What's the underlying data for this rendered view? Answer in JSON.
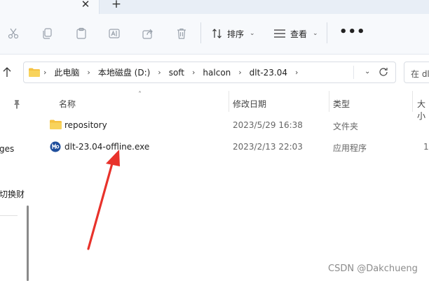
{
  "tab": {
    "close_glyph": "✕",
    "new_glyph": "+"
  },
  "toolbar": {
    "sort_label": "排序",
    "view_label": "查看",
    "more_label": "•••",
    "icons": [
      "cut-icon",
      "copy-icon",
      "paste-icon",
      "rename-icon",
      "share-icon",
      "delete-icon"
    ]
  },
  "address": {
    "crumbs": [
      "此电脑",
      "本地磁盘 (D:)",
      "soft",
      "halcon",
      "dlt-23.04"
    ],
    "search_placeholder": "在 dlt"
  },
  "nav": {
    "items": [
      "ges",
      "切换财"
    ]
  },
  "columns": {
    "name": "名称",
    "date": "修改日期",
    "type": "类型",
    "size": "大小"
  },
  "files": [
    {
      "name": "repository",
      "date": "2023/5/29 16:38",
      "type": "文件夹",
      "size": "",
      "icon": "folder-icon"
    },
    {
      "name": "dlt-23.04-offline.exe",
      "date": "2023/2/13 22:03",
      "type": "应用程序",
      "size": "1",
      "icon": "app-icon"
    }
  ],
  "annotation": {
    "arrow_color": "#e8322b"
  },
  "watermark": "CSDN @Dakchueng",
  "colors": {
    "folder": "#f5c242",
    "accent": "#1f4e9c"
  }
}
